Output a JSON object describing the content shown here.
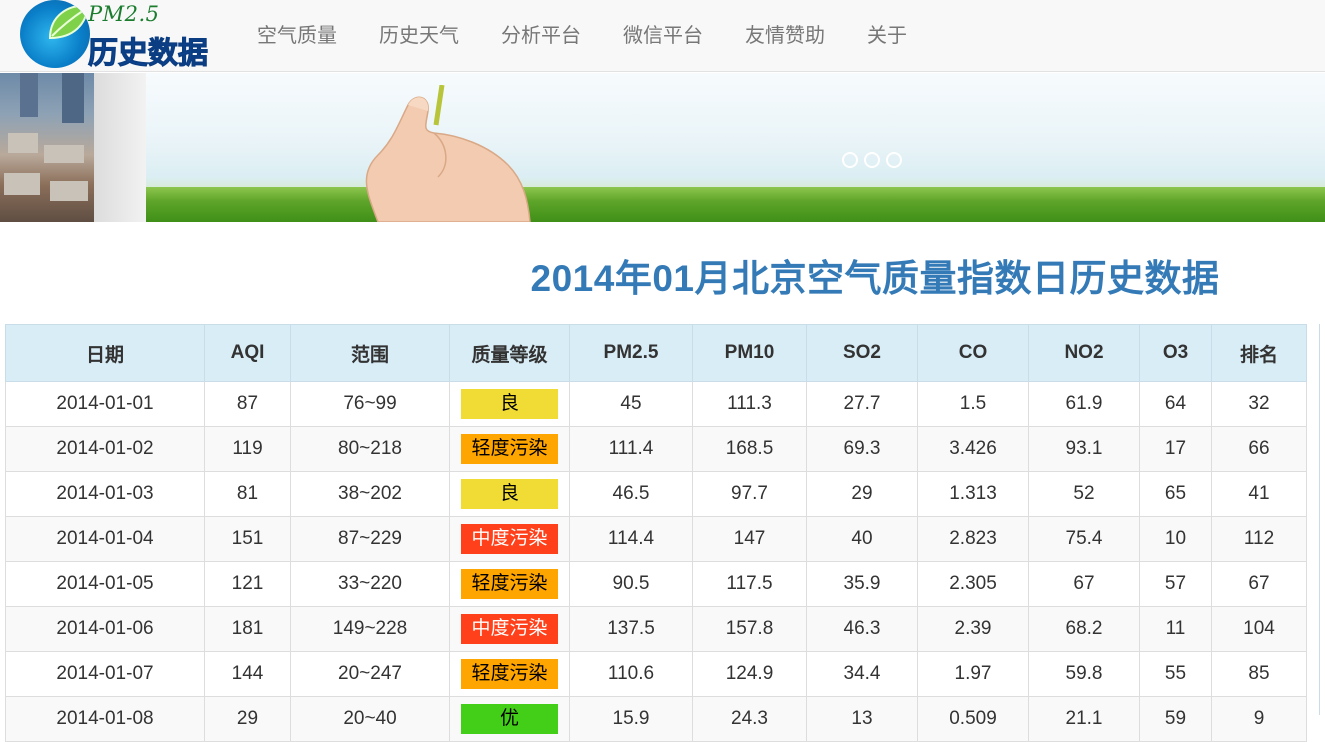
{
  "logo": {
    "pm_text": "PM2.5",
    "main_text": "历史数据"
  },
  "nav": {
    "items": [
      {
        "label": "空气质量"
      },
      {
        "label": "历史天气"
      },
      {
        "label": "分析平台"
      },
      {
        "label": "微信平台"
      },
      {
        "label": "友情赞助"
      },
      {
        "label": "关于"
      }
    ]
  },
  "carousel": {
    "indicator_count": 3
  },
  "title": "2014年01月北京空气质量指数日历史数据",
  "colors": {
    "title": "#337ab7",
    "header_bg": "#d9edf7",
    "good": "#f0dc34",
    "light": "#ffa500",
    "moderate": "#ff401a",
    "excellent": "#43ce17"
  },
  "table": {
    "headers": [
      "日期",
      "AQI",
      "范围",
      "质量等级",
      "PM2.5",
      "PM10",
      "SO2",
      "CO",
      "NO2",
      "O3",
      "排名"
    ],
    "rows": [
      {
        "date": "2014-01-01",
        "aqi": "87",
        "range": "76~99",
        "level": "良",
        "level_color": "#f0dc34",
        "level_text_color": "#000000",
        "pm25": "45",
        "pm10": "111.3",
        "so2": "27.7",
        "co": "1.5",
        "no2": "61.9",
        "o3": "64",
        "rank": "32"
      },
      {
        "date": "2014-01-02",
        "aqi": "119",
        "range": "80~218",
        "level": "轻度污染",
        "level_color": "#ffa500",
        "level_text_color": "#000000",
        "pm25": "111.4",
        "pm10": "168.5",
        "so2": "69.3",
        "co": "3.426",
        "no2": "93.1",
        "o3": "17",
        "rank": "66"
      },
      {
        "date": "2014-01-03",
        "aqi": "81",
        "range": "38~202",
        "level": "良",
        "level_color": "#f0dc34",
        "level_text_color": "#000000",
        "pm25": "46.5",
        "pm10": "97.7",
        "so2": "29",
        "co": "1.313",
        "no2": "52",
        "o3": "65",
        "rank": "41"
      },
      {
        "date": "2014-01-04",
        "aqi": "151",
        "range": "87~229",
        "level": "中度污染",
        "level_color": "#ff401a",
        "level_text_color": "#ffffff",
        "pm25": "114.4",
        "pm10": "147",
        "so2": "40",
        "co": "2.823",
        "no2": "75.4",
        "o3": "10",
        "rank": "112"
      },
      {
        "date": "2014-01-05",
        "aqi": "121",
        "range": "33~220",
        "level": "轻度污染",
        "level_color": "#ffa500",
        "level_text_color": "#000000",
        "pm25": "90.5",
        "pm10": "117.5",
        "so2": "35.9",
        "co": "2.305",
        "no2": "67",
        "o3": "57",
        "rank": "67"
      },
      {
        "date": "2014-01-06",
        "aqi": "181",
        "range": "149~228",
        "level": "中度污染",
        "level_color": "#ff401a",
        "level_text_color": "#ffffff",
        "pm25": "137.5",
        "pm10": "157.8",
        "so2": "46.3",
        "co": "2.39",
        "no2": "68.2",
        "o3": "11",
        "rank": "104"
      },
      {
        "date": "2014-01-07",
        "aqi": "144",
        "range": "20~247",
        "level": "轻度污染",
        "level_color": "#ffa500",
        "level_text_color": "#000000",
        "pm25": "110.6",
        "pm10": "124.9",
        "so2": "34.4",
        "co": "1.97",
        "no2": "59.8",
        "o3": "55",
        "rank": "85"
      },
      {
        "date": "2014-01-08",
        "aqi": "29",
        "range": "20~40",
        "level": "优",
        "level_color": "#43ce17",
        "level_text_color": "#000000",
        "pm25": "15.9",
        "pm10": "24.3",
        "so2": "13",
        "co": "0.509",
        "no2": "21.1",
        "o3": "59",
        "rank": "9"
      }
    ]
  }
}
